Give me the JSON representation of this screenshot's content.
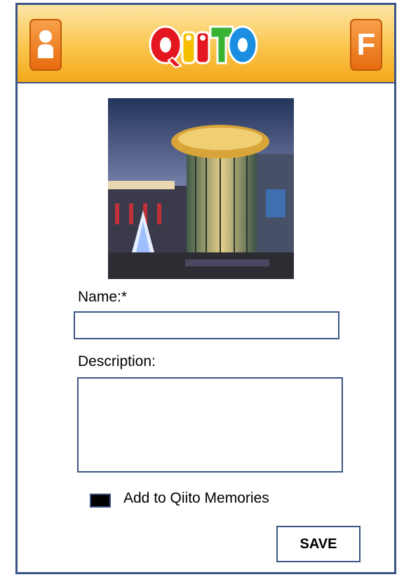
{
  "header": {
    "logo_text": "QIITO",
    "profile_icon": "person-icon",
    "right_button_label": "F"
  },
  "photo": {
    "description_icon": "building-photo"
  },
  "form": {
    "name_label": "Name:*",
    "name_value": "",
    "description_label": "Description:",
    "description_value": "",
    "checkbox_label": "Add to Qiito Memories",
    "checkbox_checked": true,
    "save_label": "SAVE"
  },
  "colors": {
    "border": "#3b5486",
    "header_top": "#fde6a6",
    "header_bottom": "#f3a81a",
    "button_orange": "#e86b10"
  }
}
